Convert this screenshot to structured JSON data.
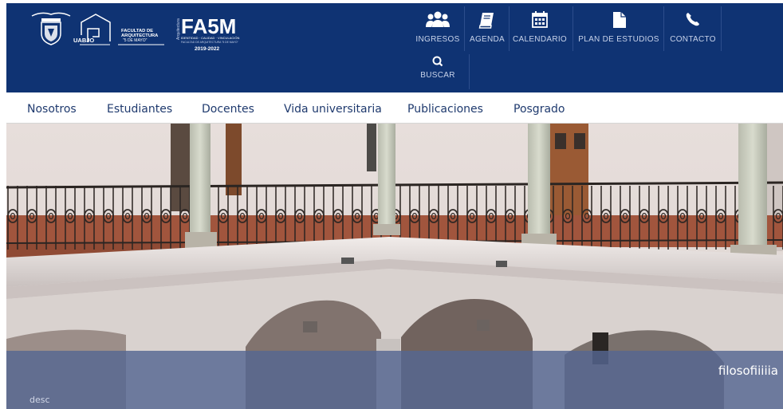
{
  "header": {
    "logos": {
      "uabjo": "UABJO",
      "faculty": [
        "FACULTAD DE",
        "ARQUITECTURA",
        "\"5 DE MAYO\""
      ],
      "fa5m_brand": "FA5M",
      "fa5m_vertical": "Arquitectura",
      "fa5m_tagline": "IDENTIDAD · CALIDAD · VINCULACIÓN",
      "fa5m_sub": "FACULTAD DE ARQUITECTURA \"5 DE MAYO\"",
      "fa5m_years": "2019-2022"
    },
    "icon_nav": [
      {
        "label": "INGRESOS",
        "icon": "users-icon"
      },
      {
        "label": "AGENDA",
        "icon": "book-icon"
      },
      {
        "label": "CALENDARIO",
        "icon": "calendar-icon"
      },
      {
        "label": "PLAN DE ESTUDIOS",
        "icon": "file-icon"
      },
      {
        "label": "CONTACTO",
        "icon": "phone-icon"
      },
      {
        "label": "BUSCAR",
        "icon": "search-icon"
      }
    ],
    "colors": {
      "bar": "#0f3373",
      "text": "#c8d3ea"
    }
  },
  "menu": {
    "items": [
      "Nosotros",
      "Estudiantes",
      "Docentes",
      "Vida universitaria",
      "Publicaciones",
      "Posgrado"
    ]
  },
  "hero": {
    "title": "filosofiiiiia",
    "desc": "desc"
  }
}
